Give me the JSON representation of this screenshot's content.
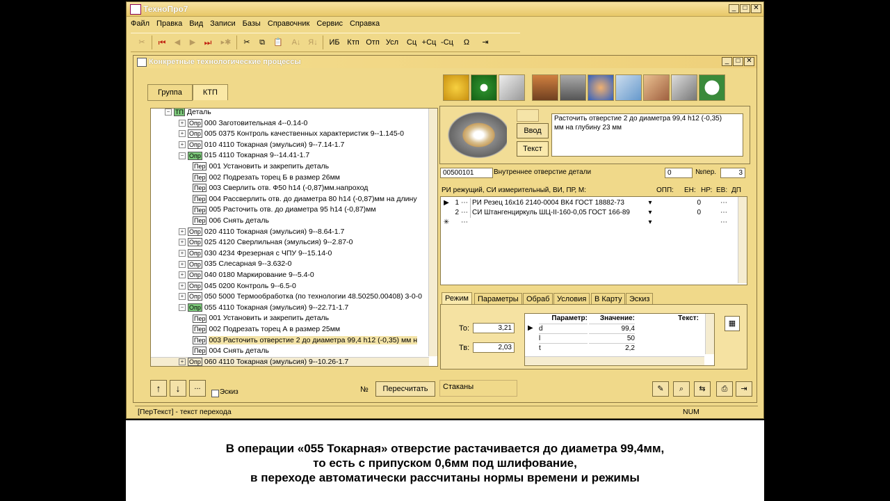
{
  "app": {
    "title": "ТехноПро7"
  },
  "menu": [
    "Файл",
    "Правка",
    "Вид",
    "Записи",
    "Базы",
    "Справочник",
    "Сервис",
    "Справка"
  ],
  "toolbar": {
    "buttons": [
      "ИБ",
      "Ктп",
      "Отп",
      "Усл",
      "Сц",
      "+Сц",
      "-Сц",
      "Ω"
    ]
  },
  "mdi": {
    "title": "Конкретные технологические процессы"
  },
  "left_tabs": [
    "Группа",
    "КТП"
  ],
  "tree": [
    {
      "kind": "ТП",
      "text": "Деталь",
      "level": 0,
      "expanded": true
    },
    {
      "kind": "Опр",
      "text": "000 Заготовительная  4--0.14-0",
      "level": 1
    },
    {
      "kind": "Опр",
      "text": "005 0375 Контроль качественных характеристик  9--1.145-0",
      "level": 1
    },
    {
      "kind": "Опр",
      "text": "010 4110 Токарная (эмульсия)  9--7.14-1.7",
      "level": 1
    },
    {
      "kind": "Опр",
      "text": "015 4110 Токарная  9--14.41-1.7",
      "level": 1,
      "expanded": true,
      "green": true
    },
    {
      "kind": "Пер",
      "text": "001 Установить и закрепить деталь",
      "level": 2
    },
    {
      "kind": "Пер",
      "text": "002 Подрезать торец Б в размер 26мм",
      "level": 2
    },
    {
      "kind": "Пер",
      "text": "003 Сверлить отв.  Ф50 h14 (-0,87)мм.напроход",
      "level": 2
    },
    {
      "kind": "Пер",
      "text": "004 Рассверлить отв. до диаметра 80 h14 (-0,87)мм на длину",
      "level": 2
    },
    {
      "kind": "Пер",
      "text": "005 Расточить отв.  до диаметра 95 h14 (-0,87)мм",
      "level": 2
    },
    {
      "kind": "Пер",
      "text": "006 Снять деталь",
      "level": 2
    },
    {
      "kind": "Опр",
      "text": "020 4110 Токарная (эмульсия)  9--8.64-1.7",
      "level": 1
    },
    {
      "kind": "Опр",
      "text": "025 4120 Сверлильная (эмульсия)  9--2.87-0",
      "level": 1
    },
    {
      "kind": "Опр",
      "text": "030 4234 Фрезерная с ЧПУ  9--15.14-0",
      "level": 1
    },
    {
      "kind": "Опр",
      "text": "035 Слесарная  9--3.632-0",
      "level": 1
    },
    {
      "kind": "Опр",
      "text": "040 0180 Маркирование  9--5.4-0",
      "level": 1
    },
    {
      "kind": "Опр",
      "text": "045 0200 Контроль  9--6.5-0",
      "level": 1
    },
    {
      "kind": "Опр",
      "text": "050 5000 Термообработка (по технологии 48.50250.00408)  3-0-0",
      "level": 1
    },
    {
      "kind": "Опр",
      "text": "055 4110 Токарная (эмульсия)  9--22.71-1.7",
      "level": 1,
      "expanded": true,
      "green": true
    },
    {
      "kind": "Пер",
      "text": "001 Установить и закрепить деталь",
      "level": 2
    },
    {
      "kind": "Пер",
      "text": "002 Подрезать торец А в размер 25мм",
      "level": 2
    },
    {
      "kind": "Пер",
      "text": "003 Расточить отверстие 2 до диаметра 99,4 h12 (-0,35) мм н",
      "level": 2,
      "selected": true
    },
    {
      "kind": "Пер",
      "text": "004 Снять деталь",
      "level": 2
    },
    {
      "kind": "Опр",
      "text": "060 4110 Токарная (эмульсия)  9--10.26-1.7",
      "level": 1
    }
  ],
  "left_bottom": {
    "recalc": "Пересчитать",
    "num": "№",
    "chk": "Эскиз"
  },
  "transition": {
    "vvod": "Ввод",
    "tekst": "Текст",
    "text": "Расточить отверстие 2 до диаметра 99,4 h12 (-0,35) мм на глубину 23 мм",
    "code": "00500101",
    "code_desc": "Внутреннее отверстие детали",
    "val0": "0",
    "nper_label": "№пер.",
    "nper": "3"
  },
  "tools": {
    "header": "РИ режущий, СИ измерительный, ВИ, ПР, М:",
    "cols": [
      "ОПП:",
      "ЕН:",
      "НР:",
      "ЕВ:",
      "ДП"
    ],
    "rows": [
      {
        "n": "1",
        "name": "РИ Резец 16х16 2140-0004 ВК4 ГОСТ 18882-73",
        "v": "0"
      },
      {
        "n": "2",
        "name": "СИ Штангенциркуль ШЦ-II-160-0,05 ГОСТ 166-89",
        "v": "0"
      }
    ]
  },
  "bottom_tabs": [
    "Режим",
    "Параметры",
    "Обраб",
    "Условия",
    "В Карту",
    "Эскиз"
  ],
  "mode": {
    "to_label": "То:",
    "to": "3,21",
    "tv_label": "Тв:",
    "tv": "2,03",
    "cols": [
      "Параметр:",
      "Значение:",
      "Текст:"
    ],
    "rows": [
      {
        "p": "d",
        "v": "99,4"
      },
      {
        "p": "l",
        "v": "50"
      },
      {
        "p": "t",
        "v": "2,2"
      }
    ]
  },
  "right_bottom": {
    "label": "Стаканы"
  },
  "status": {
    "text": "[ПерТекст] - текст перехода",
    "num": "NUM"
  },
  "caption": [
    "В операции «055 Токарная» отверстие растачивается до диаметра 99,4мм,",
    "то есть с припуском 0,6мм под шлифование,",
    "в переходе автоматически рассчитаны нормы времени и режимы"
  ]
}
